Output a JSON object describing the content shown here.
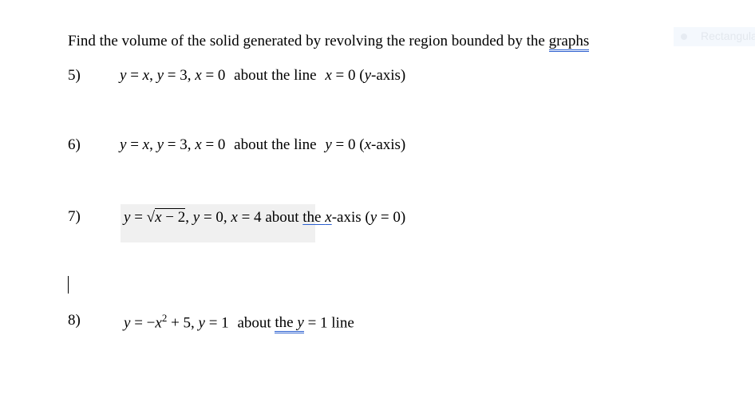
{
  "heading": {
    "text": "Find the volume of the solid generated by revolving the region bounded by the",
    "underlined_word": "graphs"
  },
  "side_chip": {
    "icon": "bullet-dot-icon",
    "label": "Rectangula"
  },
  "problems": [
    {
      "number": "5)",
      "parts": [
        "y",
        " = ",
        "x",
        ",  ",
        "y",
        " = 3,  ",
        "x",
        " = 0"
      ],
      "rest": "about the line",
      "axis_var": "x",
      "axis_eq": " = 0 (",
      "axis_name_var": "y",
      "axis_tail": "-axis)"
    },
    {
      "number": "6)",
      "parts": [
        "y",
        " = ",
        "x",
        ",  ",
        "y",
        " = 3,  ",
        "x",
        " = 0"
      ],
      "rest": "about the line",
      "axis_var": "y",
      "axis_eq": " = 0 (",
      "axis_name_var": "x",
      "axis_tail": "-axis)"
    },
    {
      "number": "7)",
      "eq_y": "y",
      "eq_eq": " = √",
      "eq_radicand_var": "x",
      "eq_radicand_rest": " − 2",
      "eq_rest1": ",  ",
      "eq_y2": "y",
      "eq_rest2": " = 0,  ",
      "eq_x": "x",
      "eq_rest3": " = 4",
      "about": "about",
      "the": "the",
      "axis_var": "x",
      "axis_tail": "-axis (",
      "paren_var": "y",
      "paren_tail": " = 0)"
    },
    {
      "number": "8)",
      "eq_y": "y",
      "eq_eq": " = −",
      "eq_x": "x",
      "eq_exp": "2",
      "eq_rest": " + 5,  ",
      "eq_y2": "y",
      "eq_rest2": " = 1",
      "about": "about",
      "the": "the",
      "line_var": "y",
      "line_tail": " = 1 line"
    }
  ]
}
